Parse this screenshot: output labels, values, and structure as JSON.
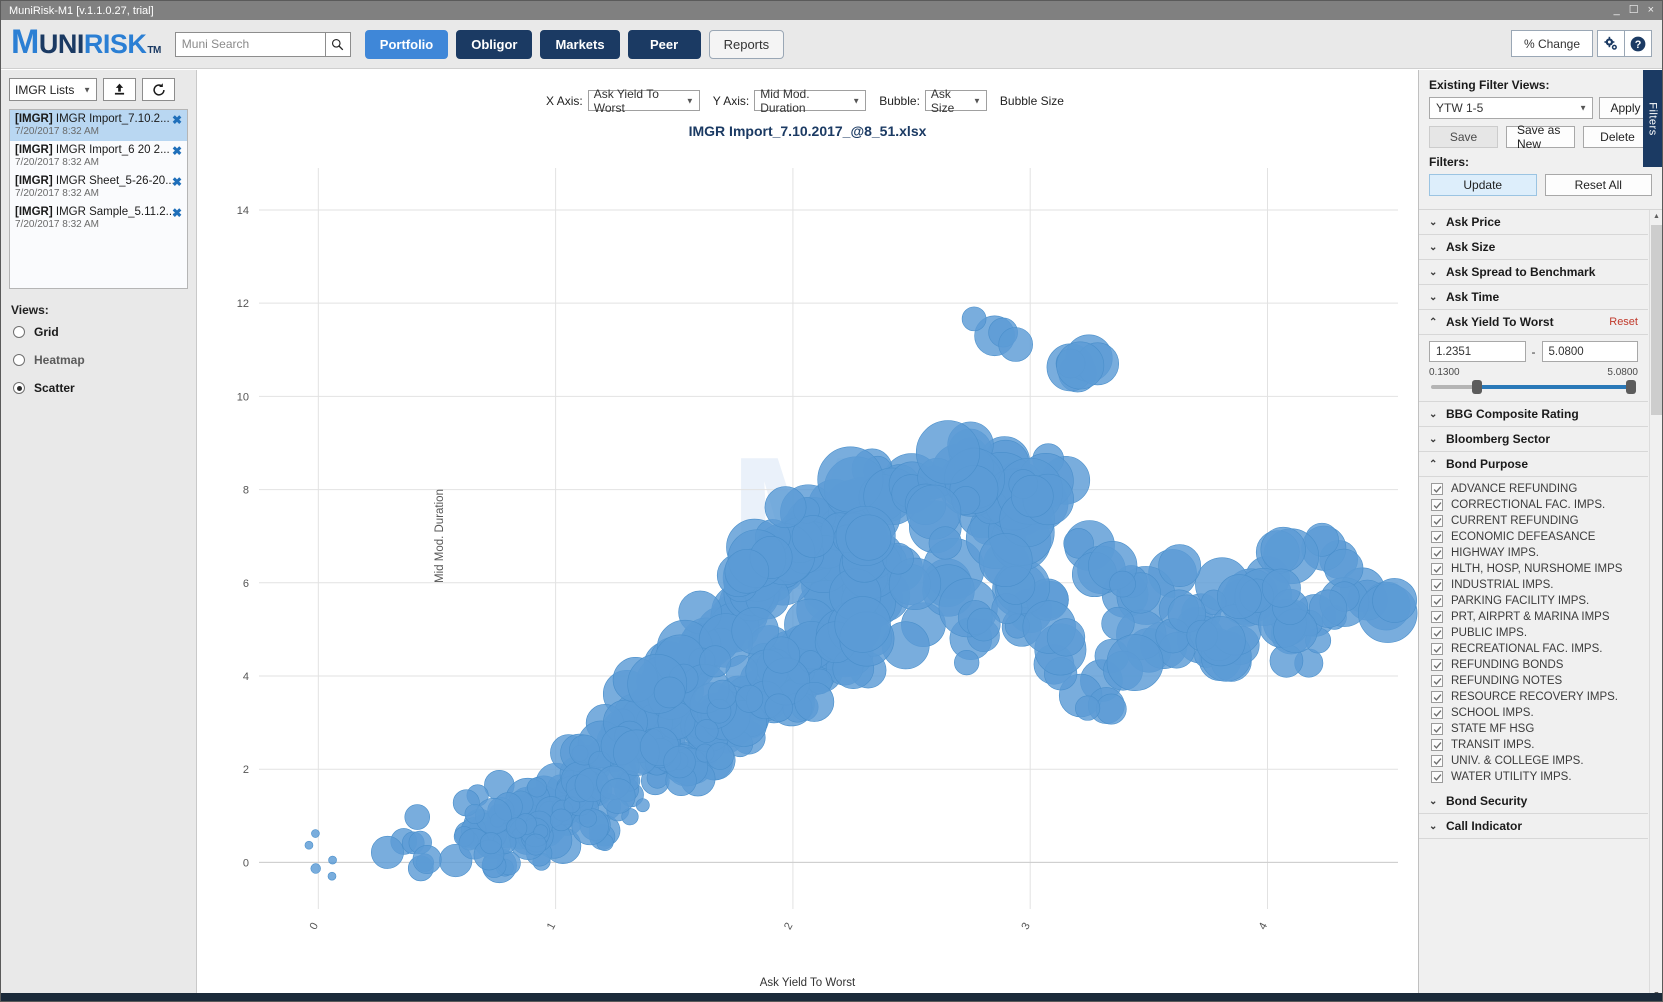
{
  "window": {
    "title": "MuniRisk-M1 [v.1.1.0.27, trial]",
    "minimize": "_",
    "maximize": "☐",
    "close": "×"
  },
  "header": {
    "logo_m": "M",
    "logo_uni": "UNI",
    "logo_risk": "RISK",
    "logo_tm": "TM",
    "search_placeholder": "Muni Search",
    "search_value": "",
    "nav": [
      {
        "label": "Portfolio",
        "active": true
      },
      {
        "label": "Obligor",
        "active": false
      },
      {
        "label": "Markets",
        "active": false
      },
      {
        "label": "Peer",
        "active": false
      },
      {
        "label": "Reports",
        "plain": true
      }
    ],
    "pct_change": "% Change",
    "settings_icon": "gear-icon",
    "help_icon": "help-icon"
  },
  "left_panel": {
    "list_selector": "IMGR Lists",
    "upload_icon": "upload-icon",
    "refresh_icon": "refresh-icon",
    "items": [
      {
        "tag": "[IMGR]",
        "name": "IMGR Import_7.10.2...",
        "date": "7/20/2017 8:32 AM",
        "selected": true
      },
      {
        "tag": "[IMGR]",
        "name": "IMGR Import_6 20 2...",
        "date": "7/20/2017 8:32 AM",
        "selected": false
      },
      {
        "tag": "[IMGR]",
        "name": "IMGR Sheet_5-26-20...",
        "date": "7/20/2017 8:32 AM",
        "selected": false
      },
      {
        "tag": "[IMGR]",
        "name": "IMGR Sample_5.11.2...",
        "date": "7/20/2017 8:32 AM",
        "selected": false
      }
    ],
    "views_label": "Views:",
    "views": [
      {
        "label": "Grid",
        "selected": false
      },
      {
        "label": "Heatmap",
        "selected": false
      },
      {
        "label": "Scatter",
        "selected": true
      }
    ]
  },
  "chart_controls": {
    "x_axis_label": "X Axis:",
    "x_axis_value": "Ask Yield To Worst",
    "y_axis_label": "Y Axis:",
    "y_axis_value": "Mid Mod. Duration",
    "bubble_label": "Bubble:",
    "bubble_value": "Ask Size",
    "bubble_size_label": "Bubble Size"
  },
  "chart_data": {
    "type": "scatter",
    "title": "IMGR Import_7.10.2017_@8_51.xlsx",
    "xlabel": "Ask Yield To Worst",
    "ylabel": "Mid Mod. Duration",
    "xlim": [
      -0.25,
      4.55
    ],
    "ylim": [
      -1.0,
      14.9
    ],
    "xticks": [
      0,
      1,
      2,
      3,
      4
    ],
    "yticks": [
      0,
      2,
      4,
      6,
      8,
      10,
      12,
      14
    ],
    "xtick_labels": [
      "0",
      "1",
      "2",
      "3",
      "4"
    ],
    "ytick_labels": [
      "0",
      "2",
      "4",
      "6",
      "8",
      "10",
      "12",
      "14"
    ],
    "grid": true,
    "legend": false,
    "bubble_color": "#5b9bd5",
    "watermark": "M",
    "size_field": "Ask Size",
    "points": [
      [
        0.06,
        0.05,
        4
      ],
      [
        0.36,
        0.45,
        13
      ],
      [
        0.4,
        0.42,
        11
      ],
      [
        0.63,
        0.6,
        13
      ],
      [
        0.68,
        0.8,
        16
      ],
      [
        0.72,
        0.55,
        15
      ],
      [
        0.76,
        0.95,
        12
      ],
      [
        0.79,
        0.7,
        18
      ],
      [
        0.82,
        1.05,
        14
      ],
      [
        0.85,
        0.5,
        10
      ],
      [
        0.88,
        1.25,
        17
      ],
      [
        0.91,
        0.85,
        12
      ],
      [
        0.95,
        1.45,
        19
      ],
      [
        0.97,
        0.65,
        14
      ],
      [
        1.0,
        1.1,
        16
      ],
      [
        1.02,
        1.6,
        13
      ],
      [
        1.05,
        0.9,
        15
      ],
      [
        1.08,
        1.35,
        18
      ],
      [
        1.1,
        1.85,
        14
      ],
      [
        1.12,
        1.05,
        11
      ],
      [
        1.15,
        2.1,
        20
      ],
      [
        1.17,
        1.55,
        16
      ],
      [
        1.2,
        2.35,
        15
      ],
      [
        1.22,
        1.2,
        13
      ],
      [
        1.25,
        2.6,
        18
      ],
      [
        1.27,
        1.95,
        17
      ],
      [
        1.3,
        2.8,
        21
      ],
      [
        1.32,
        1.45,
        12
      ],
      [
        1.35,
        3.1,
        19
      ],
      [
        1.37,
        2.25,
        16
      ],
      [
        1.4,
        3.35,
        22
      ],
      [
        1.42,
        1.75,
        14
      ],
      [
        1.45,
        3.6,
        20
      ],
      [
        1.47,
        2.55,
        18
      ],
      [
        1.5,
        3.85,
        23
      ],
      [
        1.52,
        2.05,
        15
      ],
      [
        1.55,
        4.1,
        21
      ],
      [
        1.57,
        2.9,
        19
      ],
      [
        1.6,
        4.4,
        24
      ],
      [
        1.62,
        2.35,
        16
      ],
      [
        1.65,
        4.65,
        22
      ],
      [
        1.67,
        3.2,
        20
      ],
      [
        1.7,
        4.95,
        25
      ],
      [
        1.72,
        2.7,
        17
      ],
      [
        1.75,
        5.25,
        23
      ],
      [
        1.77,
        3.55,
        21
      ],
      [
        1.8,
        5.55,
        26
      ],
      [
        1.82,
        3.05,
        18
      ],
      [
        1.85,
        5.85,
        24
      ],
      [
        1.87,
        3.9,
        22
      ],
      [
        1.9,
        6.15,
        27
      ],
      [
        1.92,
        3.4,
        19
      ],
      [
        1.95,
        6.45,
        25
      ],
      [
        1.97,
        4.25,
        23
      ],
      [
        2.0,
        6.75,
        28
      ],
      [
        2.02,
        3.75,
        20
      ],
      [
        2.05,
        7.05,
        26
      ],
      [
        2.07,
        4.6,
        24
      ],
      [
        2.1,
        7.35,
        22
      ],
      [
        2.12,
        4.1,
        21
      ],
      [
        2.15,
        5.95,
        27
      ],
      [
        2.17,
        4.95,
        25
      ],
      [
        2.2,
        6.6,
        23
      ],
      [
        2.22,
        4.45,
        22
      ],
      [
        2.25,
        7.6,
        28
      ],
      [
        2.27,
        5.3,
        26
      ],
      [
        2.3,
        6.95,
        24
      ],
      [
        2.35,
        5.65,
        27
      ],
      [
        2.4,
        7.85,
        25
      ],
      [
        2.45,
        6.3,
        23
      ],
      [
        2.5,
        8.15,
        29
      ],
      [
        2.55,
        5.1,
        22
      ],
      [
        2.6,
        7.2,
        26
      ],
      [
        2.65,
        6.0,
        24
      ],
      [
        2.7,
        8.4,
        27
      ],
      [
        2.75,
        4.8,
        21
      ],
      [
        2.8,
        7.5,
        25
      ],
      [
        2.85,
        11.3,
        20
      ],
      [
        2.9,
        6.4,
        23
      ],
      [
        2.95,
        8.0,
        28
      ],
      [
        3.0,
        5.4,
        22
      ],
      [
        3.05,
        7.7,
        26
      ],
      [
        3.1,
        4.25,
        20
      ],
      [
        3.15,
        8.2,
        24
      ],
      [
        3.2,
        10.5,
        19
      ],
      [
        3.25,
        6.8,
        25
      ],
      [
        3.3,
        3.9,
        21
      ],
      [
        3.4,
        5.75,
        23
      ],
      [
        3.5,
        4.55,
        22
      ],
      [
        3.6,
        6.2,
        24
      ],
      [
        3.7,
        5.05,
        20
      ],
      [
        3.8,
        4.35,
        21
      ],
      [
        3.9,
        5.6,
        23
      ],
      [
        4.0,
        6.1,
        22
      ],
      [
        4.1,
        4.9,
        20
      ],
      [
        4.2,
        5.3,
        21
      ],
      [
        4.3,
        6.5,
        19
      ],
      [
        4.4,
        5.85,
        22
      ],
      [
        4.5,
        5.5,
        24
      ]
    ]
  },
  "right_panel": {
    "filters_tab": "Filters",
    "existing_filter_views_label": "Existing Filter Views:",
    "filter_view_value": "YTW 1-5",
    "apply_label": "Apply",
    "save_label": "Save",
    "save_as_new_label": "Save as New",
    "delete_label": "Delete",
    "filters_label": "Filters:",
    "update_label": "Update",
    "reset_all_label": "Reset All",
    "sections": [
      {
        "title": "Ask Price",
        "expanded": false
      },
      {
        "title": "Ask Size",
        "expanded": false
      },
      {
        "title": "Ask Spread to Benchmark",
        "expanded": false
      },
      {
        "title": "Ask Time",
        "expanded": false
      },
      {
        "title": "Ask Yield To Worst",
        "expanded": true,
        "reset_label": "Reset",
        "range_min_value": "1.2351",
        "range_max_value": "5.0800",
        "range_separator": "-",
        "scale_min": "0.1300",
        "scale_max": "5.0800"
      },
      {
        "title": "BBG Composite Rating",
        "expanded": false
      },
      {
        "title": "Bloomberg Sector",
        "expanded": false
      },
      {
        "title": "Bond Purpose",
        "expanded": true,
        "checkboxes": [
          {
            "label": "ADVANCE REFUNDING",
            "checked": true
          },
          {
            "label": "CORRECTIONAL FAC. IMPS.",
            "checked": true
          },
          {
            "label": "CURRENT REFUNDING",
            "checked": true
          },
          {
            "label": "ECONOMIC DEFEASANCE",
            "checked": true
          },
          {
            "label": "HIGHWAY IMPS.",
            "checked": true
          },
          {
            "label": "HLTH, HOSP, NURSHOME IMPS",
            "checked": true
          },
          {
            "label": "INDUSTRIAL IMPS.",
            "checked": true
          },
          {
            "label": "PARKING FACILITY IMPS.",
            "checked": true
          },
          {
            "label": "PRT, AIRPRT & MARINA IMPS",
            "checked": true
          },
          {
            "label": "PUBLIC IMPS.",
            "checked": true
          },
          {
            "label": "RECREATIONAL FAC. IMPS.",
            "checked": true
          },
          {
            "label": "REFUNDING BONDS",
            "checked": true
          },
          {
            "label": "REFUNDING NOTES",
            "checked": true
          },
          {
            "label": "RESOURCE RECOVERY IMPS.",
            "checked": true
          },
          {
            "label": "SCHOOL IMPS.",
            "checked": true
          },
          {
            "label": "STATE MF HSG",
            "checked": true
          },
          {
            "label": "TRANSIT IMPS.",
            "checked": true
          },
          {
            "label": "UNIV. & COLLEGE IMPS.",
            "checked": true
          },
          {
            "label": "WATER UTILITY IMPS.",
            "checked": true
          }
        ]
      },
      {
        "title": "Bond Security",
        "expanded": false
      },
      {
        "title": "Call Indicator",
        "expanded": false
      }
    ]
  }
}
